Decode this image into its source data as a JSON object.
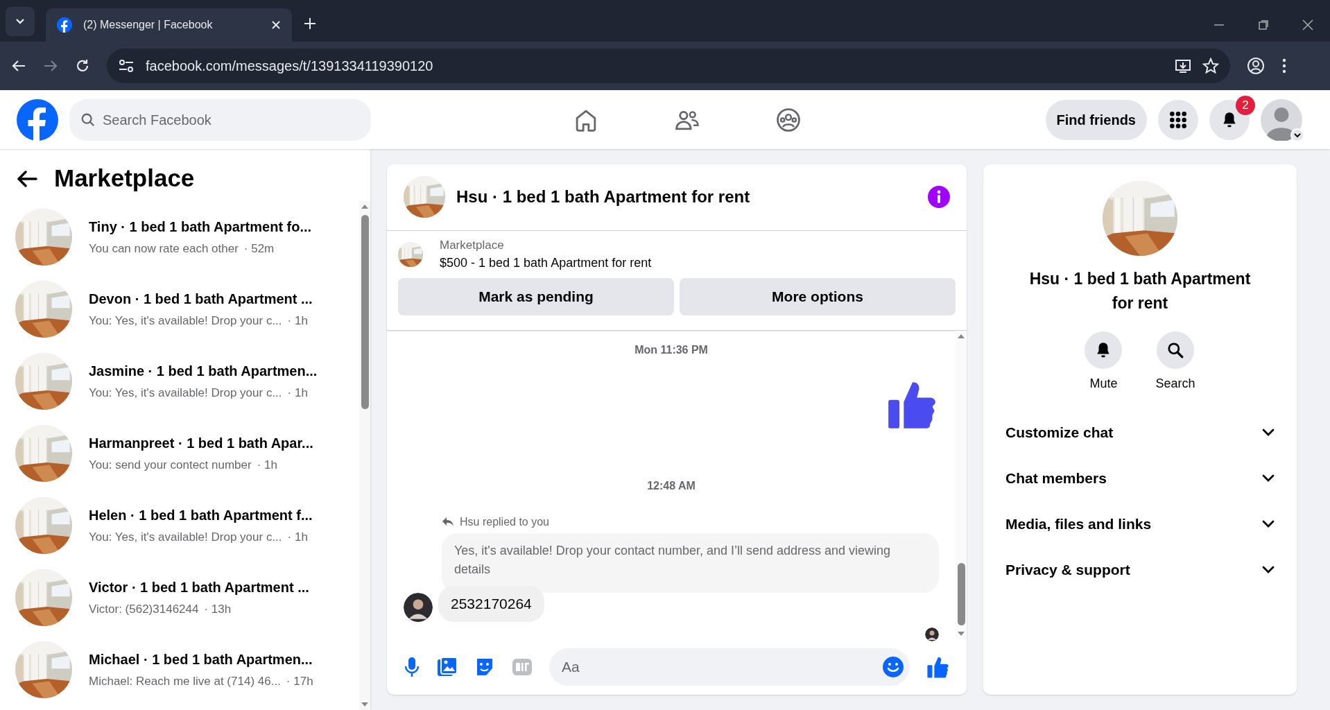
{
  "browser": {
    "tab_title": "(2) Messenger | Facebook",
    "url": "facebook.com/messages/t/1391334119390120"
  },
  "header": {
    "search_placeholder": "Search Facebook",
    "find_friends": "Find friends",
    "notification_count": "2"
  },
  "sidebar": {
    "title": "Marketplace",
    "conversations": [
      {
        "name": "Tiny · 1 bed 1 bath Apartment fo...",
        "preview": "You can now rate each other",
        "time": "· 52m"
      },
      {
        "name": "Devon · 1 bed 1 bath Apartment ...",
        "preview": "You: Yes, it's available! Drop your c...",
        "time": "· 1h"
      },
      {
        "name": "Jasmine · 1 bed 1 bath Apartmen...",
        "preview": "You: Yes, it's available! Drop your c...",
        "time": "· 1h"
      },
      {
        "name": "Harmanpreet · 1 bed 1 bath Apar...",
        "preview": "You: send your contect number",
        "time": "· 1h"
      },
      {
        "name": "Helen · 1 bed 1 bath Apartment f...",
        "preview": "You: Yes, it's available! Drop your c...",
        "time": "· 1h"
      },
      {
        "name": "Victor · 1 bed 1 bath Apartment ...",
        "preview": "Victor: (562)3146244",
        "time": "· 13h"
      },
      {
        "name": "Michael · 1 bed 1 bath Apartmen...",
        "preview": "Michael: Reach me live at (714) 46...",
        "time": "· 17h"
      }
    ]
  },
  "chat": {
    "title": "Hsu · 1 bed 1 bath Apartment for rent",
    "listing": {
      "source": "Marketplace",
      "title": "$500 - 1 bed 1 bath Apartment for rent"
    },
    "actions": [
      "Mark as pending",
      "More options"
    ],
    "messages": [
      {
        "kind": "timestamp",
        "text": "Mon 11:36 PM"
      },
      {
        "kind": "like"
      },
      {
        "kind": "timestamp",
        "text": "12:48 AM"
      },
      {
        "kind": "reply_note",
        "text": "Hsu replied to you"
      },
      {
        "kind": "quoted",
        "text": "Yes, it's available! Drop your contact number, and I’ll send address and viewing details"
      },
      {
        "kind": "received",
        "text": "2532170264"
      },
      {
        "kind": "seen"
      }
    ],
    "composer": {
      "placeholder": "Aa"
    }
  },
  "details": {
    "title": "Hsu · 1 bed 1 bath Apartment for rent",
    "actions": [
      {
        "kind": "mute",
        "label": "Mute"
      },
      {
        "kind": "search",
        "label": "Search"
      }
    ],
    "sections": [
      "Customize chat",
      "Chat members",
      "Media, files and links",
      "Privacy & support"
    ]
  }
}
